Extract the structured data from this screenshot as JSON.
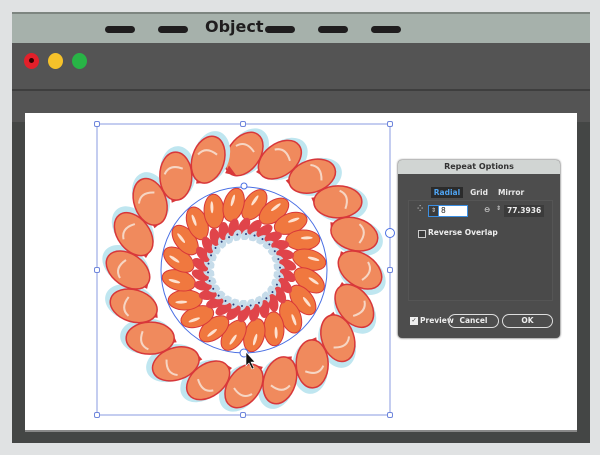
{
  "menubar": {
    "title": "Object"
  },
  "colors": {
    "accent": "#4a6fe3",
    "close": "#e2202a",
    "minimize": "#f6c22a",
    "maximize": "#28b446"
  },
  "dialog": {
    "title": "Repeat Options",
    "tabs": [
      {
        "label": "Radial",
        "active": true
      },
      {
        "label": "Grid"
      },
      {
        "label": "Mirror"
      }
    ],
    "instances_value": "8",
    "radius_value": "77.3936 p",
    "reverse_overlap_label": "Reverse Overlap",
    "reverse_overlap_checked": false,
    "preview_label": "Preview",
    "preview_checked": true,
    "cancel_label": "Cancel",
    "ok_label": "OK"
  }
}
